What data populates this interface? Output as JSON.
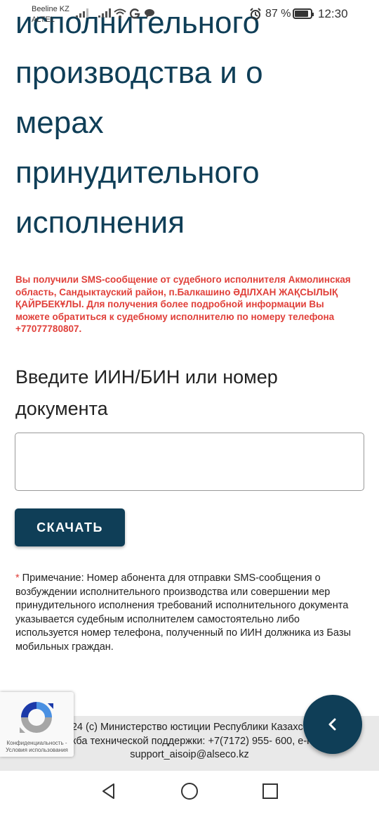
{
  "status_bar": {
    "carrier_1": "Beeline KZ",
    "carrier_2": "ALTEL",
    "battery_percent": "87 %",
    "battery_level": 0.87,
    "time": "12:30",
    "icons": [
      "signal-icon",
      "signal-icon",
      "wifi-icon",
      "google-icon",
      "chat-icon",
      "alarm-icon",
      "battery-icon"
    ]
  },
  "page": {
    "heading_lines": [
      "исполнительного",
      "производства и о",
      "мерах",
      "принудительного",
      "исполнения"
    ],
    "sms_notice": "Вы получили SMS-сообщение от судебного исполнителя Акмолинская область, Сандыктауский район, п.Балкашино ӘДІЛХАН ЖАҚСЫЛЫҚ ҚАЙРБЕКҰЛЫ. Для получения более подробной информации Вы можете обратиться к судебному исполнителю по номеру телефона +77077780807.",
    "field_label": "Введите ИИН/БИН или номер документа",
    "field_value": "",
    "download_button": "СКАЧАТЬ",
    "note_star": "*",
    "note_text": " Примечание: Номер абонента для отправки SMS-сообщения о возбуждении исполнительного производства или совершении мер принудительного исполнения требований исполнительного документа указывается судебным исполнителем самостоятельно либо используется номер телефона, полученный по ИИН должника из Базы мобильных граждан."
  },
  "footer": {
    "line_1": "2024 (с) Министерство юстиции Республики Казахстан",
    "line_2": "Служба технической поддержки: +7(7172) 955- 600, e-mail:",
    "line_3": "support_aisoip@alseco.kz"
  },
  "recaptcha": {
    "links": "Конфиденциальность - Условия использования"
  },
  "colors": {
    "primary": "#0f3e57",
    "alert": "#e0403a",
    "footer_bg": "#e9e9e9"
  }
}
